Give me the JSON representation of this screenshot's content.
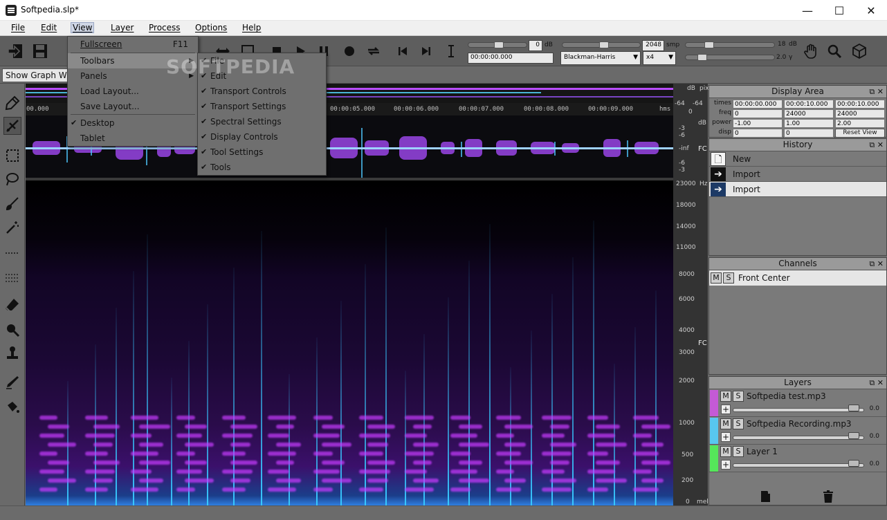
{
  "window": {
    "title": "Softpedia.slp*",
    "minimize": "—",
    "maximize": "☐",
    "close": "✕"
  },
  "menubar": [
    "File",
    "Edit",
    "View",
    "Layer",
    "Process",
    "Options",
    "Help"
  ],
  "view_menu": {
    "fullscreen": "Fullscreen",
    "fullscreen_shortcut": "F11",
    "toolbars": "Toolbars",
    "panels": "Panels",
    "load_layout": "Load Layout...",
    "save_layout": "Save Layout...",
    "desktop": "Desktop",
    "tablet": "Tablet"
  },
  "toolbars_submenu": [
    "File",
    "Edit",
    "Transport Controls",
    "Transport Settings",
    "Spectral Settings",
    "Display Controls",
    "Tool Settings",
    "Tools"
  ],
  "watermark": "SOFTPEDIA",
  "toolbar": {
    "gain_value": "0",
    "gain_unit": "dB",
    "time_value": "00:00:00.000",
    "fft_size": "2048",
    "fft_unit": "smp",
    "window_type": "Blackman-Harris",
    "overlap": "x4",
    "range_value": "18",
    "range_unit": "dB",
    "gamma_value": "2.0",
    "gamma_unit": "γ"
  },
  "show_graph": "Show Graph Window",
  "timeline": [
    "00.000",
    "00:00:05.000",
    "00:00:06.000",
    "00:00:07.000",
    "00:00:08.000",
    "00:00:09.000"
  ],
  "timeline_unit": "hms",
  "ruler": {
    "top_labels": [
      "dB",
      "pix",
      "-64",
      "-64",
      "0"
    ],
    "db_unit": "dB",
    "wave_labels": [
      "-3",
      "-6",
      "-inf",
      "-6",
      "-3"
    ],
    "channel_tag": "FC",
    "hz_unit": "Hz",
    "freq_labels": [
      "23000",
      "18000",
      "14000",
      "11000",
      "8000",
      "6000",
      "4000",
      "3000",
      "2000",
      "1000",
      "500",
      "200",
      "0"
    ],
    "bottom_unit": "mel"
  },
  "display_area": {
    "title": "Display Area",
    "rows": [
      {
        "label": "times",
        "v1": "00:00:00.000",
        "v2": "00:00:10.000",
        "v3": "00:00:10.000"
      },
      {
        "label": "freq",
        "v1": "0",
        "v2": "24000",
        "v3": "24000"
      },
      {
        "label": "power",
        "v1": "-1.00",
        "v2": "1.00",
        "v3": "2.00"
      },
      {
        "label": "disp",
        "v1": "0",
        "v2": "0",
        "v3": ""
      }
    ],
    "reset": "Reset View"
  },
  "history": {
    "title": "History",
    "items": [
      "New",
      "Import",
      "Import"
    ]
  },
  "channels": {
    "title": "Channels",
    "items": [
      "Front Center"
    ]
  },
  "layers": {
    "title": "Layers",
    "items": [
      {
        "name": "Softpedia test.mp3",
        "color": "#c45ad6",
        "value": "0.0",
        "level": 0.92
      },
      {
        "name": "Softpedia Recording.mp3",
        "color": "#58c7ef",
        "value": "0.0",
        "level": 0.92
      },
      {
        "name": "Layer 1",
        "color": "#55e65a",
        "value": "0.0",
        "level": 0.92
      }
    ]
  },
  "ms": {
    "m": "M",
    "s": "S",
    "plus": "+"
  }
}
